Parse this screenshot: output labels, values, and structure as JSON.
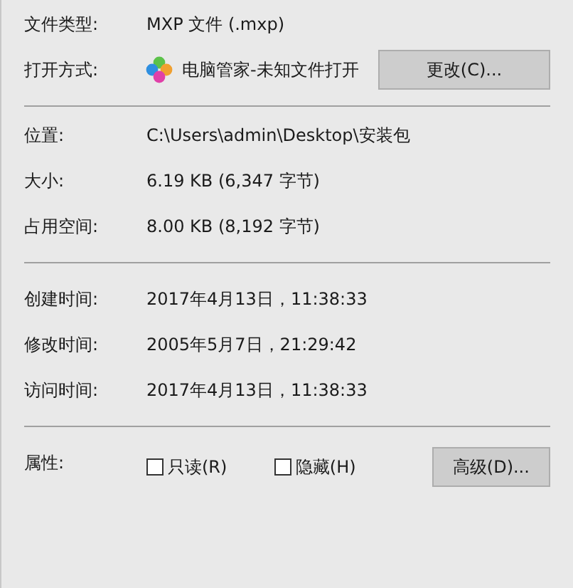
{
  "groups": [
    [
      {
        "kind": "text",
        "label": "文件类型:",
        "value": "MXP 文件 (.mxp)"
      },
      {
        "kind": "app",
        "label": "打开方式:",
        "value": "电脑管家-未知文件打开",
        "button": "更改(C)..."
      }
    ],
    [
      {
        "kind": "text",
        "label": "位置:",
        "value": "C:\\Users\\admin\\Desktop\\安装包"
      },
      {
        "kind": "text",
        "label": "大小:",
        "value": "6.19 KB (6,347 字节)"
      },
      {
        "kind": "text",
        "label": "占用空间:",
        "value": "8.00 KB (8,192 字节)"
      }
    ],
    [
      {
        "kind": "text",
        "label": "创建时间:",
        "value": "2017年4月13日，11:38:33"
      },
      {
        "kind": "text",
        "label": "修改时间:",
        "value": "2005年5月7日，21:29:42"
      },
      {
        "kind": "text",
        "label": "访问时间:",
        "value": "2017年4月13日，11:38:33"
      }
    ]
  ],
  "attributes": {
    "label": "属性:",
    "checkboxes": [
      {
        "label": "只读(R)",
        "checked": false
      },
      {
        "label": "隐藏(H)",
        "checked": false
      }
    ],
    "button": "高级(D)..."
  }
}
